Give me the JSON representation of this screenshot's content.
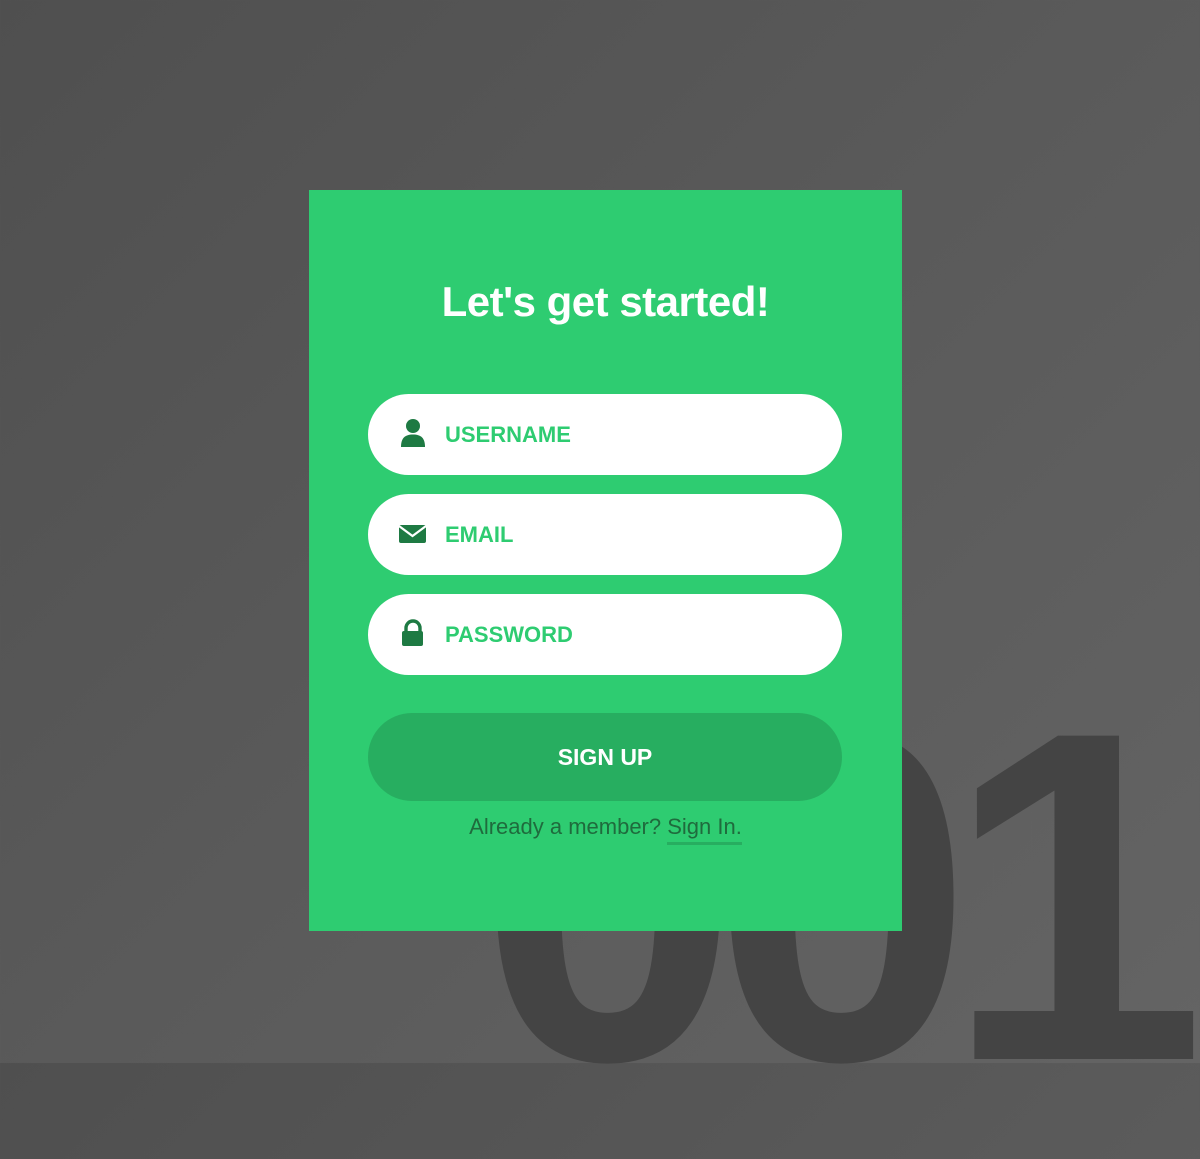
{
  "background": {
    "number_text": "001",
    "color": "#555555"
  },
  "card": {
    "title": "Let's get started!",
    "color": "#2ecc71",
    "fields": {
      "username": {
        "placeholder": "USERNAME",
        "value": "",
        "icon": "user-icon"
      },
      "email": {
        "placeholder": "EMAIL",
        "value": "",
        "icon": "envelope-icon"
      },
      "password": {
        "placeholder": "PASSWORD",
        "value": "",
        "icon": "lock-icon"
      }
    },
    "signup_button": {
      "label": "SIGN UP",
      "color": "#27ae60"
    },
    "footer": {
      "text": "Already a member? ",
      "link_label": "Sign In."
    }
  },
  "colors": {
    "accent": "#2ecc71",
    "accent_dark": "#27ae60",
    "icon": "#1e7a43",
    "text_dark": "#1f6b3d"
  }
}
